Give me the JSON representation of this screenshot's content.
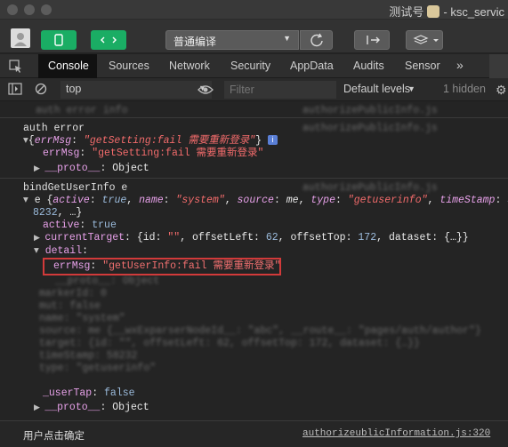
{
  "window": {
    "title": "测试号",
    "subtitle": "ksc_servic"
  },
  "toolbar": {
    "compile_mode": "普通编译"
  },
  "tabs": [
    "Console",
    "Sources",
    "Network",
    "Security",
    "AppData",
    "Audits",
    "Sensor"
  ],
  "tabs_more": "»",
  "filterbar": {
    "context": "top",
    "filter_placeholder": "Filter",
    "levels": "Default levels",
    "hidden": "1 hidden"
  },
  "console": {
    "auth_error": "auth error",
    "l1_key": "errMsg",
    "l1_val": "\"getSetting:fail 需要重新登录\"",
    "l2_key": "errMsg",
    "l2_val": "\"getSetting:fail 需要重新登录\"",
    "proto": "__proto__",
    "object": "Object",
    "bind_title": "bindGetUserInfo e",
    "e_prefix": "e {",
    "active_key": "active",
    "true_val": "true",
    "name_key": "name",
    "name_val": "\"system\"",
    "source_key": "source",
    "source_val": "me",
    "type_key": "type",
    "type_val": "\"getuserinfo\"",
    "ts_key": "timeStamp",
    "ts_val": "5",
    "ts_cont": "8232",
    "ellipsis": "…}",
    "active_line_key": "active",
    "active_line_val": "true",
    "ct_key": "currentTarget",
    "ct_id_key": "id",
    "ct_id_val": "\"\"",
    "ct_ol_key": "offsetLeft",
    "ct_ol_val": "62",
    "ct_ot_key": "offsetTop",
    "ct_ot_val": "172",
    "ct_ds_key": "dataset",
    "ct_ds_val": "{…}}",
    "detail_key": "detail",
    "err_key": "errMsg",
    "err_val": "\"getUserInfo:fail 需要重新登录\"",
    "usertap_key": "_userTap",
    "usertap_val": "false",
    "proto2": "__proto__",
    "object2": "Object"
  },
  "status": {
    "left": "用户点击确定",
    "source": "authorizeublicInformation.js:320"
  },
  "colors": {
    "accent_green": "#1aad64",
    "highlight_border": "#d23a3a",
    "string": "#f26b6b",
    "key": "#e6a0e8"
  }
}
